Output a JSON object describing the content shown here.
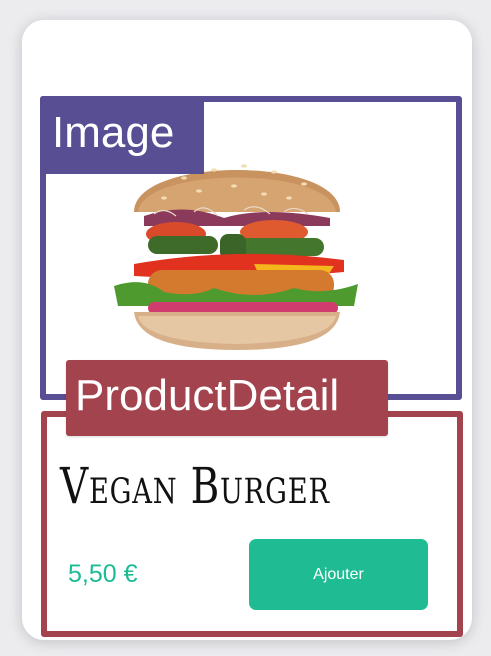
{
  "labels": {
    "image_tag": "Image",
    "detail_tag": "ProductDetail"
  },
  "product": {
    "name": "Vegan Burger",
    "price": "5,50 €",
    "add_button_label": "Ajouter",
    "image_icon": "vegan-burger-photo"
  },
  "colors": {
    "image_frame": "#584e93",
    "detail_frame": "#a3434d",
    "accent": "#1fbc94"
  }
}
